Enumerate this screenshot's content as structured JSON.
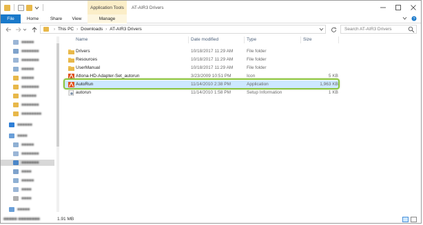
{
  "window": {
    "title": "AT-AIR3 Drivers",
    "context_group": "Application Tools"
  },
  "ribbon": {
    "tabs": [
      "File",
      "Home",
      "Share",
      "View",
      "Manage"
    ]
  },
  "address": {
    "crumbs": [
      "This PC",
      "Downloads",
      "AT-AIR3 Drivers"
    ],
    "search_placeholder": "Search AT-AIR3 Drivers"
  },
  "columns": {
    "name": "Name",
    "date": "Date modified",
    "type": "Type",
    "size": "Size"
  },
  "files": [
    {
      "name": "Drivers",
      "date": "10/18/2017 11:29 AM",
      "type": "File folder",
      "size": "",
      "icon": "folder-icon"
    },
    {
      "name": "Resources",
      "date": "10/18/2017 11:29 AM",
      "type": "File folder",
      "size": "",
      "icon": "folder-icon"
    },
    {
      "name": "UserManual",
      "date": "10/18/2017 11:29 AM",
      "type": "File folder",
      "size": "",
      "icon": "folder-icon"
    },
    {
      "name": "Atlona-HD-Adapter-Set_autorun",
      "date": "3/23/2009 10:51 PM",
      "type": "Icon",
      "size": "5 KB",
      "icon": "atlona-icon"
    },
    {
      "name": "AutoRun",
      "date": "11/14/2010 2:38 PM",
      "type": "Application",
      "size": "1,963 KB",
      "icon": "atlona-app-icon",
      "selected": true
    },
    {
      "name": "autorun",
      "date": "11/14/2010 1:58 PM",
      "type": "Setup Information",
      "size": "1 KB",
      "icon": "setup-info-icon"
    }
  ],
  "status": {
    "selected_size": "1.91 MB"
  },
  "colors": {
    "file_tab": "#1979ca",
    "selection": "#cde8ff",
    "highlight_frame": "#8cc540",
    "context_tab": "#fbeec8"
  }
}
